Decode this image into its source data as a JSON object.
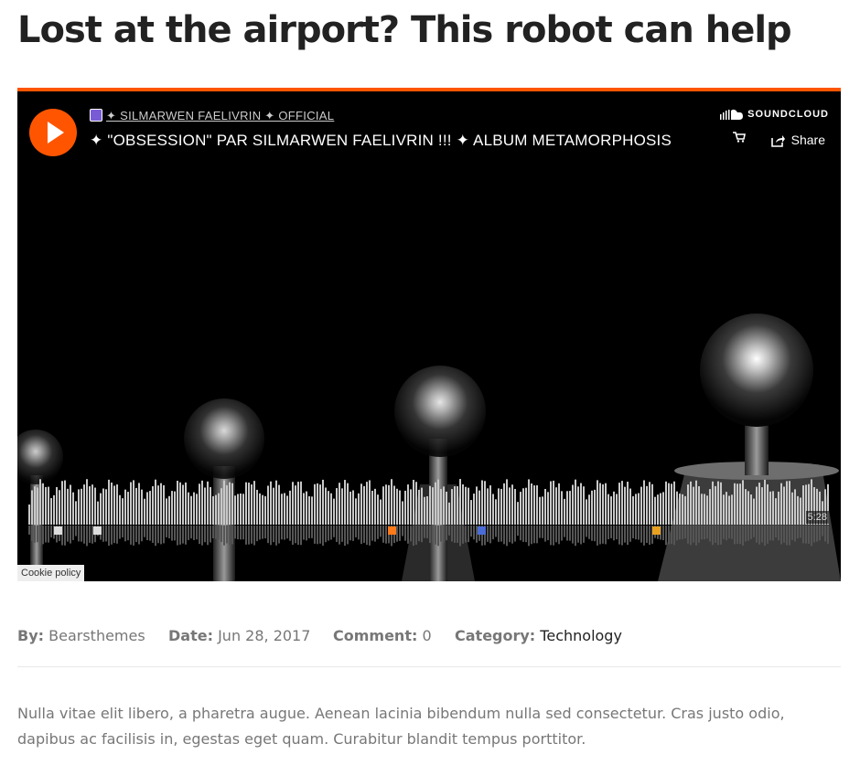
{
  "post": {
    "title": "Lost at the airport? This robot can help",
    "meta": {
      "by_label": "By:",
      "by_value": "Bearsthemes",
      "date_label": "Date:",
      "date_value": "Jun 28, 2017",
      "comment_label": "Comment:",
      "comment_value": "0",
      "category_label": "Category:",
      "category_value": "Technology"
    },
    "excerpt": "Nulla vitae elit libero, a pharetra augue. Aenean lacinia bibendum nulla sed consectetur. Cras justo odio, dapibus ac facilisis in, egestas eget quam. Curabitur blandit tempus porttitor."
  },
  "player": {
    "artist": "✦ SILMARWEN FAELIVRIN ✦ OFFICIAL",
    "track": "✦ \"OBSESSION\" PAR SILMARWEN FAELIVRIN !!! ✦ ALBUM METAMORPHOSIS",
    "brand": "SOUNDCLOUD",
    "share_label": "Share",
    "duration": "5:28",
    "cookie_label": "Cookie policy",
    "accent_color": "#ff5500",
    "icons": [
      "play-icon",
      "soundcloud-logo-icon",
      "cart-icon",
      "share-icon",
      "comment-avatar-icon"
    ]
  }
}
